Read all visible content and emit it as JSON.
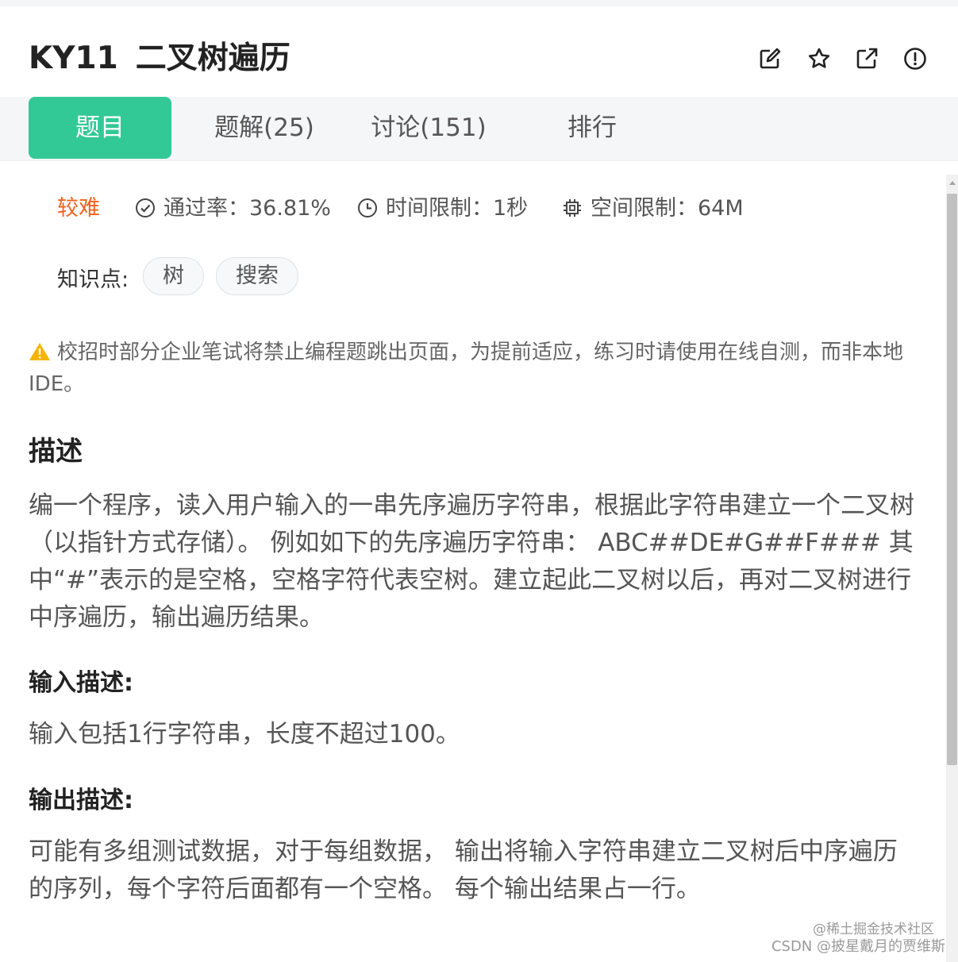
{
  "problem": {
    "code": "KY11",
    "title": "二叉树遍历"
  },
  "actions": {
    "edit_icon": "edit-icon",
    "star_icon": "star-icon",
    "share_icon": "external-link-icon",
    "report_icon": "alert-circle-icon"
  },
  "tabs": [
    {
      "label": "题目",
      "active": true
    },
    {
      "label": "题解(25)",
      "active": false
    },
    {
      "label": "讨论(151)",
      "active": false
    },
    {
      "label": "排行",
      "active": false
    }
  ],
  "meta": {
    "difficulty": "较难",
    "pass_rate": "通过率：36.81%",
    "time_limit": "时间限制：1秒",
    "space_limit": "空间限制：64M"
  },
  "knowledge": {
    "label": "知识点:",
    "tags": [
      "树",
      "搜索"
    ]
  },
  "notice": "校招时部分企业笔试将禁止编程题跳出页面，为提前适应，练习时请使用在线自测，而非本地IDE。",
  "description": {
    "heading": "描述",
    "text": "编一个程序，读入用户输入的一串先序遍历字符串，根据此字符串建立一个二叉树（以指针方式存储）。 例如如下的先序遍历字符串： ABC##DE#G##F### 其中“#”表示的是空格，空格字符代表空树。建立起此二叉树以后，再对二叉树进行中序遍历，输出遍历结果。"
  },
  "input_desc": {
    "heading": "输入描述:",
    "text": "输入包括1行字符串，长度不超过100。"
  },
  "output_desc": {
    "heading": "输出描述:",
    "text": "可能有多组测试数据，对于每组数据， 输出将输入字符串建立二叉树后中序遍历的序列，每个字符后面都有一个空格。 每个输出结果占一行。"
  },
  "watermark": {
    "line1": "@稀土掘金技术社区",
    "line2": "CSDN @披星戴月的贾维斯"
  },
  "colors": {
    "accent": "#32c997",
    "difficulty": "#f0621e",
    "warning": "#f5b400"
  }
}
